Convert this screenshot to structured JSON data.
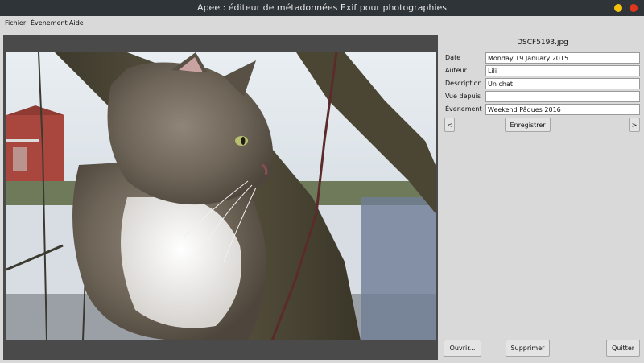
{
  "window": {
    "title": "Apee : éditeur de métadonnées Exif pour photographies"
  },
  "menu": {
    "file": "Fichier",
    "event": "Évenement",
    "help": "Aide"
  },
  "image": {
    "filename": "DSCF5193.jpg",
    "subject": "cat photo"
  },
  "fields": {
    "date": {
      "label": "Date",
      "value": "Monday 19 January 2015"
    },
    "author": {
      "label": "Auteur",
      "value": "Lili"
    },
    "description": {
      "label": "Description",
      "value": "Un chat"
    },
    "seen_from": {
      "label": "Vue depuis",
      "value": ""
    },
    "event": {
      "label": "Évenement",
      "value": "Weekend Pâques 2016"
    }
  },
  "buttons": {
    "prev": "<",
    "save": "Enregistrer",
    "next": ">",
    "open": "Ouvrir...",
    "delete": "Supprimer",
    "quit": "Quitter"
  },
  "colors": {
    "titlebar": "#2f3438",
    "window_bg": "#d9d9d9",
    "image_frame": "#4a4a4a",
    "minimize": "#f5c211",
    "close": "#e0361b"
  }
}
